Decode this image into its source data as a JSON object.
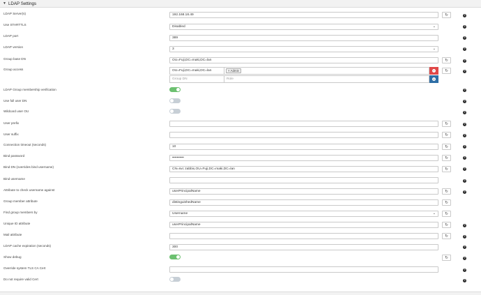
{
  "panel": {
    "title": "LDAP Settings",
    "collapse_icon": "chevron-down-icon"
  },
  "icons": {
    "reset": "sync-icon",
    "help": "question-circle-icon",
    "remove": "minus-circle-icon",
    "add": "plus-circle-icon"
  },
  "fields": {
    "servers": {
      "label": "LDAP Server(s)",
      "value": "192.168.18.49"
    },
    "starttls": {
      "label": "Use STARTTLS",
      "value": "Disabled"
    },
    "port": {
      "label": "LDAP port",
      "value": "389"
    },
    "version": {
      "label": "LDAP version",
      "value": "3"
    },
    "group_base_dn": {
      "label": "Group base DN",
      "value": "OU=Fuji,DC=maki,DC=lan"
    },
    "group_access": {
      "label": "Group access",
      "dn_value": "OU=Fuji,DC=maki,DC=lan",
      "role_tag": "× Admin",
      "new_dn_placeholder": "Group DN",
      "new_role_placeholder": "Role"
    },
    "group_membership": {
      "label": "LDAP Group membership verification",
      "on": true
    },
    "full_user_dn": {
      "label": "Use full user DN",
      "on": false
    },
    "wildcard_user_ou": {
      "label": "Wildcard user OU",
      "on": false
    },
    "user_prefix": {
      "label": "User prefix",
      "value": ""
    },
    "user_suffix": {
      "label": "User suffix",
      "value": ""
    },
    "timeout": {
      "label": "Connection timeout (seconds)",
      "value": "10"
    },
    "bind_password": {
      "label": "Bind password",
      "value": "••••••••••"
    },
    "bind_dn": {
      "label": "Bind DN (overrides bind username)",
      "value": "CN=svc zabbix,OU=Fuji,DC=maki,DC=lan"
    },
    "bind_username": {
      "label": "Bind username",
      "value": ""
    },
    "username_attr": {
      "label": "Attribute to check username against",
      "value": "userPrincipalName"
    },
    "group_member_attr": {
      "label": "Group member attribute",
      "value": "distinguishedName"
    },
    "find_members_by": {
      "label": "Find group members by",
      "value": "Username"
    },
    "unique_id_attr": {
      "label": "Unique ID attribute",
      "value": "userPrincipalName"
    },
    "mail_attr": {
      "label": "Mail attribute",
      "value": ""
    },
    "cache_expiration": {
      "label": "LDAP cache expiration (seconds)",
      "value": "300"
    },
    "show_debug": {
      "label": "Show debug",
      "on": true
    },
    "tls_ca_cert": {
      "label": "Override system TLS CA Cert",
      "value": ""
    },
    "no_valid_cert": {
      "label": "Do not require valid Cert",
      "on": false
    }
  }
}
